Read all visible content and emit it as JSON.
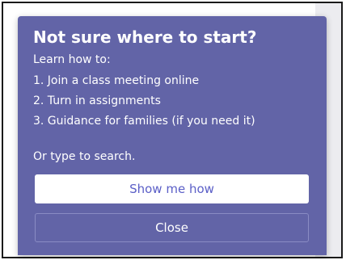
{
  "popup": {
    "title": "Not sure where to start?",
    "intro": "Learn how to:",
    "steps": [
      "1. Join a class meeting online",
      "2. Turn in assignments",
      "3. Guidance for families (if you need it)"
    ],
    "hint": "Or type to search.",
    "primary_button": "Show me how",
    "secondary_button": "Close",
    "accent_color": "#6264a7",
    "button_text_color": "#5b5fc7"
  }
}
